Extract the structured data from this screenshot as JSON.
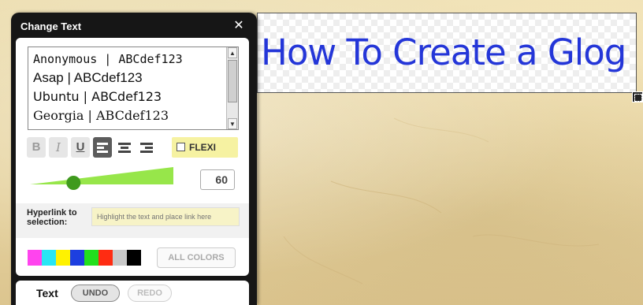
{
  "panel": {
    "title": "Change Text",
    "close_icon": "close-icon",
    "close_glyph": "✕"
  },
  "fonts": [
    {
      "label": "Anonymous  |  ABCdef123"
    },
    {
      "label": "Asap | ABCdef123"
    },
    {
      "label": "Ubuntu | ABCdef123"
    },
    {
      "label": "Georgia | ABCdef123"
    }
  ],
  "format": {
    "bold_label": "B",
    "italic_label": "I",
    "underline_label": "U",
    "bold_active": false,
    "italic_active": false,
    "underline_active": true,
    "alignment": "left",
    "flexi_label": "FLEXI",
    "flexi_checked": false
  },
  "size": {
    "value": "60",
    "slider_fraction": 0.29
  },
  "hyperlink": {
    "label": "Hyperlink to selection:",
    "placeholder": "Highlight the text and place link here"
  },
  "colors": {
    "swatches": [
      "#ff44ee",
      "#29e6f4",
      "#fff200",
      "#1d3fe0",
      "#22e01e",
      "#ff2c12",
      "#c9c9c9",
      "#000000"
    ],
    "all_colors_label": "ALL COLORS",
    "slider_accent": "#97e64a"
  },
  "footer": {
    "label": "Text",
    "undo_label": "UNDO",
    "redo_label": "REDO"
  },
  "canvas": {
    "text": "How To Create a Glog",
    "text_color": "#2436d8"
  }
}
